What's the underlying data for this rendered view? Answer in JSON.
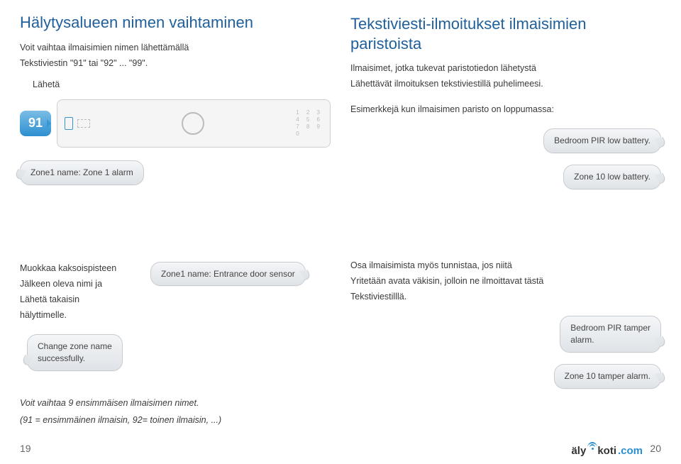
{
  "left": {
    "heading": "Hälytysalueen nimen vaihtaminen",
    "intro1": "Voit vaihtaa ilmaisimien nimen lähettämällä",
    "intro2": "Tekstiviestin \"91\" tai \"92\" ... \"99\".",
    "send": "Lähetä",
    "sms_code": "91",
    "sms_reply1": "Zone1 name: Zone 1 alarm",
    "mid_para1": "Muokkaa kaksoispisteen",
    "mid_para2": "Jälkeen oleva nimi ja",
    "mid_para3": "Lähetä takaisin",
    "mid_para4": "hälyttimelle.",
    "sms_edit": "Zone1 name: Entrance door sensor",
    "sms_success1": "Change zone name",
    "sms_success2": "successfully.",
    "footer1": "Voit vaihtaa 9 ensimmäisen ilmaisimen nimet.",
    "footer2": "(91 = ensimmäinen ilmaisin, 92= toinen ilmaisin, ...)"
  },
  "right": {
    "heading": "Tekstiviesti-ilmoitukset ilmaisimien paristoista",
    "intro1": "Ilmaisimet, jotka tukevat paristotiedon lähetystä",
    "intro2": "Lähettävät ilmoituksen tekstiviestillä puhelimeesi.",
    "intro3": "Esimerkkejä kun ilmaisimen paristo on loppumassa:",
    "sms_low1": "Bedroom PIR low battery.",
    "sms_low2": "Zone 10 low battery.",
    "mid_para1": "Osa ilmaisimista myös tunnistaa, jos niitä",
    "mid_para2": "Yritetään avata väkisin, jolloin ne ilmoittavat tästä",
    "mid_para3": "Tekstiviestilllä.",
    "sms_tamper1a": "Bedroom PIR tamper",
    "sms_tamper1b": "alarm.",
    "sms_tamper2": "Zone 10 tamper alarm."
  },
  "pages": {
    "left_num": "19",
    "right_num": "20"
  },
  "logo": {
    "brand1": "äly",
    "brand2": "koti",
    "tld": ".com"
  }
}
